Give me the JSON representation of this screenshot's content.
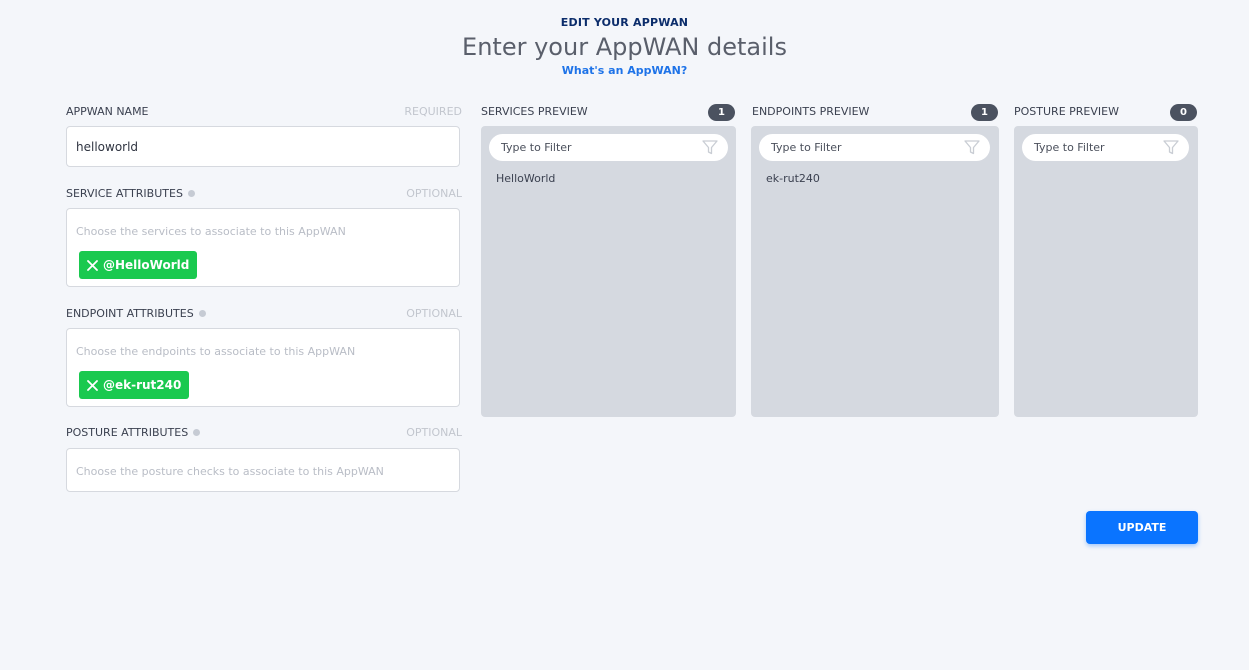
{
  "header": {
    "subtitle": "EDIT YOUR APPWAN",
    "title": "Enter your AppWAN details",
    "help_link": "What's an AppWAN?"
  },
  "form": {
    "appwan_name": {
      "label": "APPWAN NAME",
      "hint": "REQUIRED",
      "value": "helloworld"
    },
    "service_attributes": {
      "label": "SERVICE ATTRIBUTES",
      "hint": "OPTIONAL",
      "placeholder": "Choose the services to associate to this AppWAN",
      "chips": [
        "@HelloWorld"
      ]
    },
    "endpoint_attributes": {
      "label": "ENDPOINT ATTRIBUTES",
      "hint": "OPTIONAL",
      "placeholder": "Choose the endpoints to associate to this AppWAN",
      "chips": [
        "@ek-rut240"
      ]
    },
    "posture_attributes": {
      "label": "POSTURE ATTRIBUTES",
      "hint": "OPTIONAL",
      "placeholder": "Choose the posture checks to associate to this AppWAN",
      "chips": []
    }
  },
  "previews": {
    "services": {
      "label": "SERVICES PREVIEW",
      "count": "1",
      "filter_placeholder": "Type to Filter",
      "items": [
        "HelloWorld"
      ]
    },
    "endpoints": {
      "label": "ENDPOINTS PREVIEW",
      "count": "1",
      "filter_placeholder": "Type to Filter",
      "items": [
        "ek-rut240"
      ]
    },
    "posture": {
      "label": "POSTURE PREVIEW",
      "count": "0",
      "filter_placeholder": "Type to Filter",
      "items": []
    }
  },
  "actions": {
    "update_label": "UPDATE"
  },
  "colors": {
    "accent": "#0a74ff",
    "chip": "#1ac94f",
    "heading": "#0c2d6b",
    "panel": "#d5d9e0"
  },
  "icons": {
    "chip_remove": "close-icon",
    "filter": "funnel-icon",
    "info": "info-icon"
  }
}
